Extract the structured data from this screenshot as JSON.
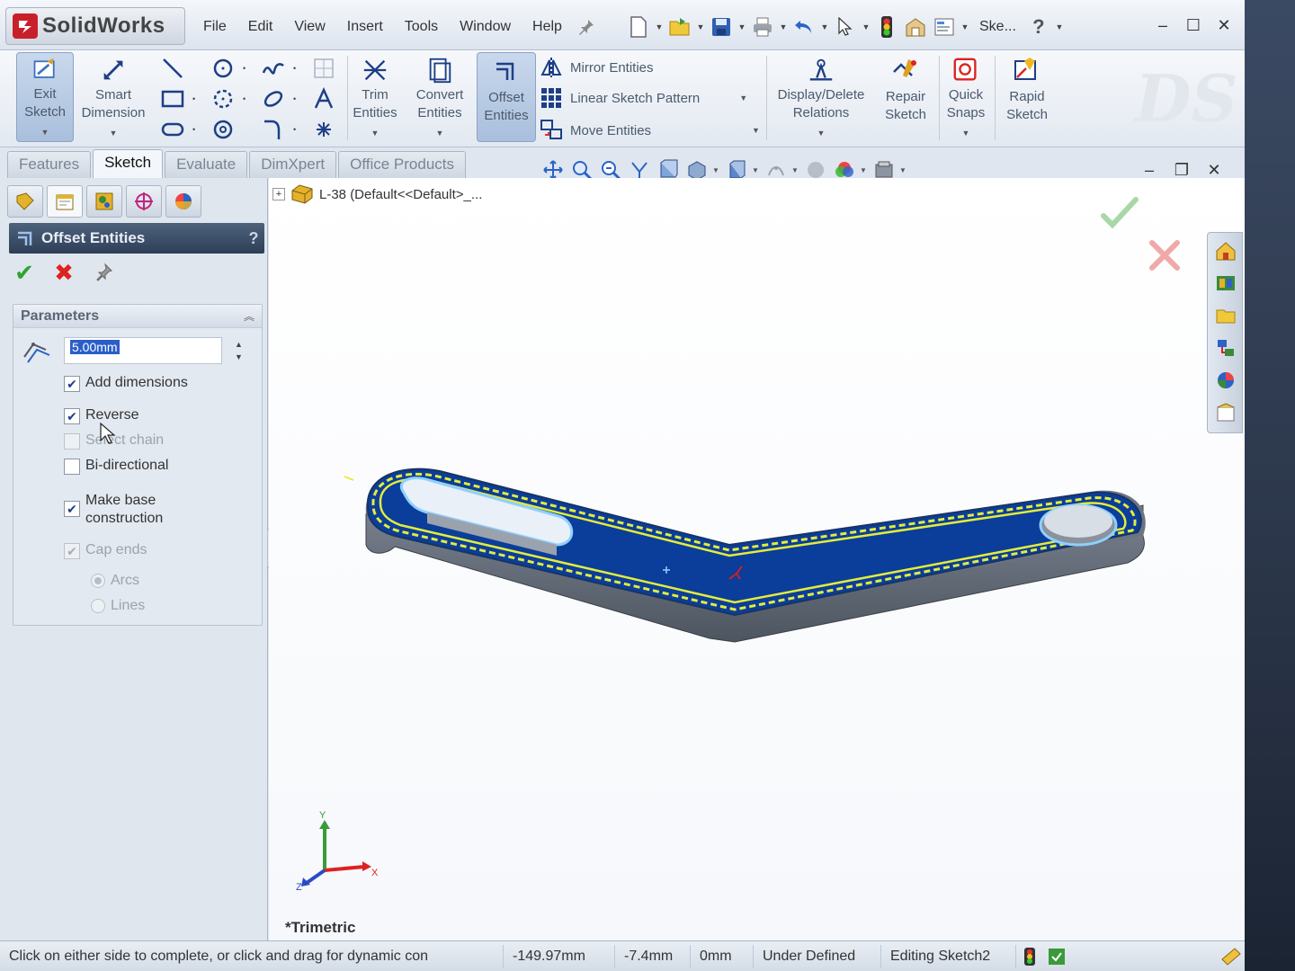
{
  "app": {
    "logo_text": "SolidWorks",
    "menu": [
      "File",
      "Edit",
      "View",
      "Insert",
      "Tools",
      "Window",
      "Help"
    ],
    "document_short_name": "Ske..."
  },
  "command_manager": {
    "exit_sketch": "Exit Sketch",
    "smart_dimension": "Smart Dimension",
    "trim_entities": "Trim Entities",
    "convert_entities": "Convert Entities",
    "offset_entities": "Offset Entities",
    "mirror_entities": "Mirror Entities",
    "linear_sketch_pattern": "Linear Sketch Pattern",
    "move_entities": "Move Entities",
    "display_delete_relations": "Display/Delete Relations",
    "repair_sketch": "Repair Sketch",
    "quick_snaps": "Quick Snaps",
    "rapid_sketch": "Rapid Sketch",
    "watermark": "DS"
  },
  "tabs": [
    {
      "label": "Features",
      "active": false
    },
    {
      "label": "Sketch",
      "active": true
    },
    {
      "label": "Evaluate",
      "active": false
    },
    {
      "label": "DimXpert",
      "active": false
    },
    {
      "label": "Office Products",
      "active": false
    }
  ],
  "property_manager": {
    "title": "Offset Entities",
    "help": "?",
    "parameters": {
      "heading": "Parameters",
      "offset_distance": "5.00mm",
      "options": [
        {
          "label": "Add dimensions",
          "checked": true,
          "enabled": true
        },
        {
          "label": "Reverse",
          "checked": true,
          "enabled": true
        },
        {
          "label": "Select chain",
          "checked": false,
          "enabled": false
        },
        {
          "label": "Bi-directional",
          "checked": false,
          "enabled": true
        },
        {
          "label": "Make base construction",
          "checked": true,
          "enabled": true
        },
        {
          "label": "Cap ends",
          "checked": true,
          "enabled": false
        }
      ],
      "cap_types": [
        {
          "label": "Arcs",
          "selected": true
        },
        {
          "label": "Lines",
          "selected": false
        }
      ]
    }
  },
  "graphics": {
    "tree_label": "L-38  (Default<<Default>_...",
    "view_orientation": "*Trimetric",
    "triad_labels": {
      "x": "X",
      "y": "Y",
      "z": "Z"
    },
    "colors": {
      "face": "#0b3d9a",
      "side": "#5e6670",
      "offset_line": "#e3ec3a",
      "preview": "#8fd0ff"
    }
  },
  "status_bar": {
    "message": "Click on either side to complete, or click and drag for dynamic con",
    "x": "-149.97mm",
    "y": "-7.4mm",
    "z": "0mm",
    "sketch_state": "Under Defined",
    "editing": "Editing Sketch2"
  }
}
